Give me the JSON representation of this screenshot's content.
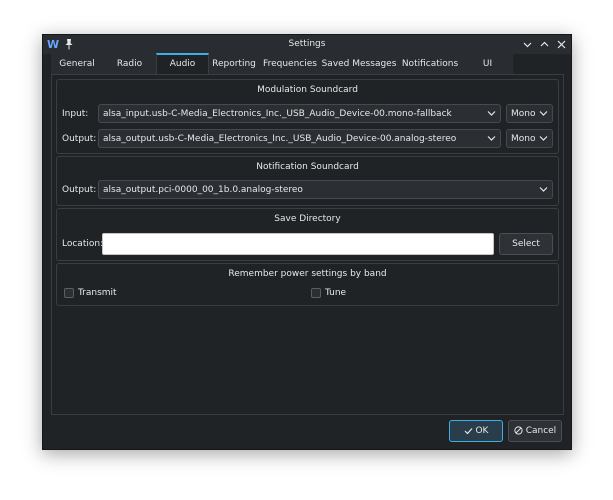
{
  "window": {
    "title": "Settings",
    "app_logo": "W"
  },
  "titlebar": {
    "icons": [
      "app-logo-icon",
      "pin-icon",
      "minimize-icon",
      "maximize-icon",
      "close-icon"
    ]
  },
  "tabs": [
    {
      "label": "General"
    },
    {
      "label": "Radio"
    },
    {
      "label": "Audio",
      "active": true
    },
    {
      "label": "Reporting"
    },
    {
      "label": "Frequencies"
    },
    {
      "label": "Saved Messages"
    },
    {
      "label": "Notifications"
    },
    {
      "label": "UI"
    }
  ],
  "modulation": {
    "title": "Modulation Soundcard",
    "input_label": "Input:",
    "input_device": "alsa_input.usb-C-Media_Electronics_Inc._USB_Audio_Device-00.mono-fallback",
    "input_channels": "Mono",
    "output_label": "Output:",
    "output_device": "alsa_output.usb-C-Media_Electronics_Inc._USB_Audio_Device-00.analog-stereo",
    "output_channels": "Mono"
  },
  "notification": {
    "title": "Notification Soundcard",
    "output_label": "Output:",
    "output_device": "alsa_output.pci-0000_00_1b.0.analog-stereo"
  },
  "save_directory": {
    "title": "Save Directory",
    "location_label": "Location:",
    "location_value": "",
    "select_label": "Select"
  },
  "power": {
    "title": "Remember power settings by band",
    "transmit_label": "Transmit",
    "transmit_checked": false,
    "tune_label": "Tune",
    "tune_checked": false
  },
  "footer": {
    "ok_label": "OK",
    "cancel_label": "Cancel"
  },
  "colors": {
    "accent": "#3daee9",
    "window_bg": "#202326",
    "text": "#e6e8ea"
  }
}
